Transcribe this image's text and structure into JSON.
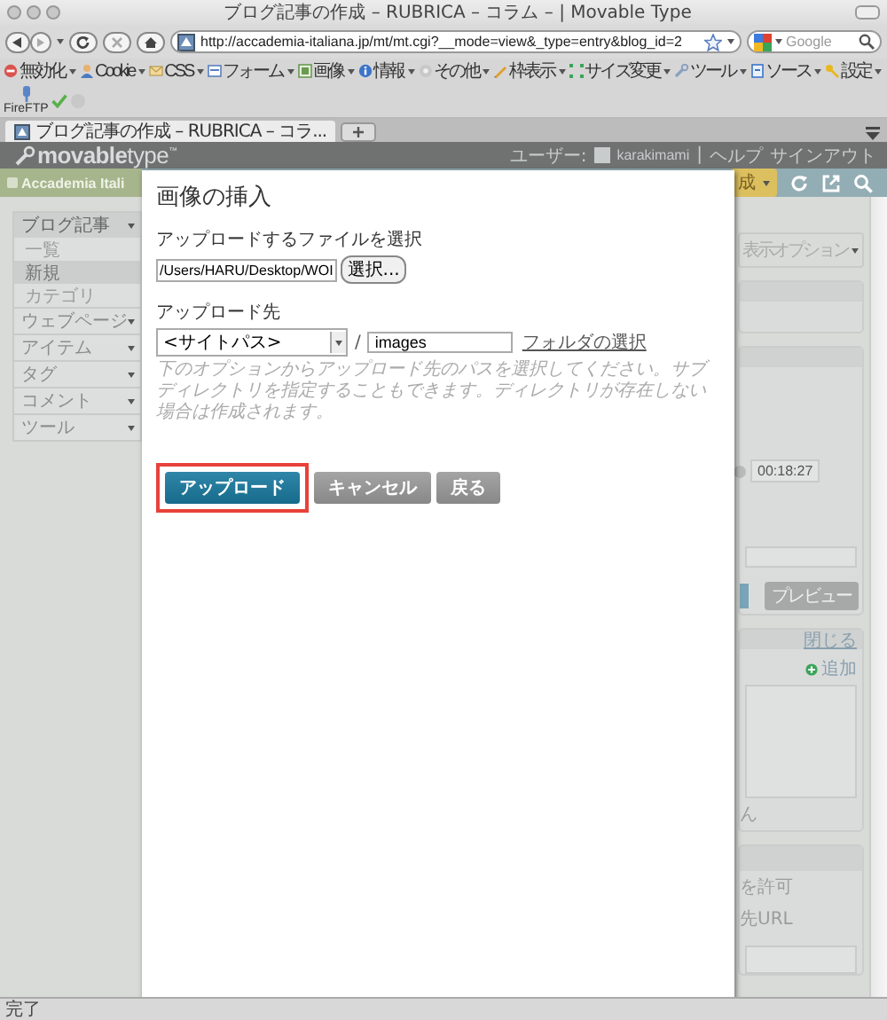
{
  "window": {
    "title": "ブログ記事の作成 – RUBRICA – コラム – | Movable Type"
  },
  "navigation": {
    "url": "http://accademia-italiana.jp/mt/mt.cgi?__mode=view&_type=entry&blog_id=2",
    "search": {
      "placeholder": "Google"
    }
  },
  "bookmarks": [
    {
      "label": "無効化",
      "kind": "menu"
    },
    {
      "label": "Cookie",
      "kind": "menu"
    },
    {
      "label": "CSS",
      "kind": "menu"
    },
    {
      "label": "フォーム",
      "kind": "menu"
    },
    {
      "label": "画像",
      "kind": "menu"
    },
    {
      "label": "情報",
      "kind": "menu"
    },
    {
      "label": "その他",
      "kind": "menu"
    },
    {
      "label": "枠表示",
      "kind": "menu"
    },
    {
      "label": "サイズ変更",
      "kind": "menu"
    },
    {
      "label": "ツール",
      "kind": "menu"
    },
    {
      "label": "ソース",
      "kind": "menu"
    },
    {
      "label": "設定",
      "kind": "menu"
    },
    {
      "label": "FireFTP",
      "kind": "stacked"
    }
  ],
  "tabs": [
    {
      "label": "ブログ記事の作成 – RUBRICA – コラ...",
      "selected": true
    }
  ],
  "header": {
    "logo": "**movable**type$^{™}$",
    "user_label": "ユーザー:",
    "username": "karakimami",
    "divider": "|",
    "links": [
      "ヘルプ",
      "サインアウト"
    ]
  },
  "blog_bar": {
    "blog_name": "Accademia Itali",
    "create_menu": "成"
  },
  "sidebar": {
    "menus": [
      {
        "label": "ブログ記事",
        "expanded": true,
        "children": [
          {
            "label": "一覧",
            "selected": false
          },
          {
            "label": "新規",
            "selected": true
          },
          {
            "label": "カテゴリ",
            "selected": false
          }
        ]
      },
      {
        "label": "ウェブページ",
        "expanded": false
      },
      {
        "label": "アイテム",
        "expanded": false
      },
      {
        "label": "タグ",
        "expanded": false
      },
      {
        "label": "コメント",
        "expanded": false
      },
      {
        "label": "ツール",
        "expanded": false
      }
    ]
  },
  "right_column": {
    "display_options": "表示オプション",
    "time": "00:18:27",
    "preview_button": "プレビュー",
    "close_link": "閉じる",
    "add_link": "追加",
    "fragments": [
      "ん",
      "を許可",
      "先URL"
    ]
  },
  "dialog": {
    "title": "画像の挿入",
    "file_label": "アップロードするファイルを選択",
    "file_path": "/Users/HARU/Desktop/WOI",
    "browse_button": "選択...",
    "destination_label": "アップロード先",
    "destination_select": "<サイトパス>",
    "separator": "/",
    "folder_value": "images",
    "folder_link": "フォルダの選択",
    "help": "下のオプションからアップロード先のパスを選択してください。サブディレクトリを指定することもできます。ディレクトリが存在しない場合は作成されます。",
    "buttons": [
      {
        "label": "アップロード",
        "kind": "primary",
        "highlighted": true
      },
      {
        "label": "キャンセル",
        "kind": "secondary",
        "highlighted": false
      },
      {
        "label": "戻る",
        "kind": "secondary",
        "highlighted": false
      }
    ]
  },
  "status_bar": "完了"
}
